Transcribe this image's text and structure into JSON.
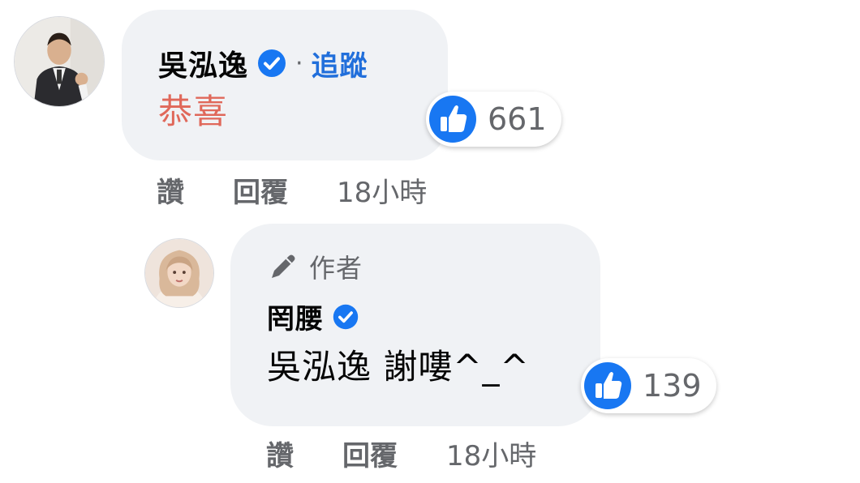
{
  "comments": [
    {
      "author": "吳泓逸",
      "verified": true,
      "separator": "·",
      "follow_label": "追蹤",
      "text": "恭喜",
      "text_color": "#e0685a",
      "reaction_count": "661",
      "actions": {
        "like": "讚",
        "reply": "回覆",
        "time": "18小時"
      },
      "avatar_icon": "avatar-man-suit"
    },
    {
      "badge": "作者",
      "badge_icon": "pen-icon",
      "author": "罔腰",
      "verified": true,
      "text": "吳泓逸 謝嘍^_^",
      "text_color": "#050505",
      "reaction_count": "139",
      "actions": {
        "like": "讚",
        "reply": "回覆",
        "time": "18小時"
      },
      "avatar_icon": "avatar-woman"
    }
  ],
  "colors": {
    "bubble": "#f0f2f5",
    "link_blue": "#216fdb",
    "like_blue": "#1877f2",
    "secondary_text": "#65676b"
  }
}
